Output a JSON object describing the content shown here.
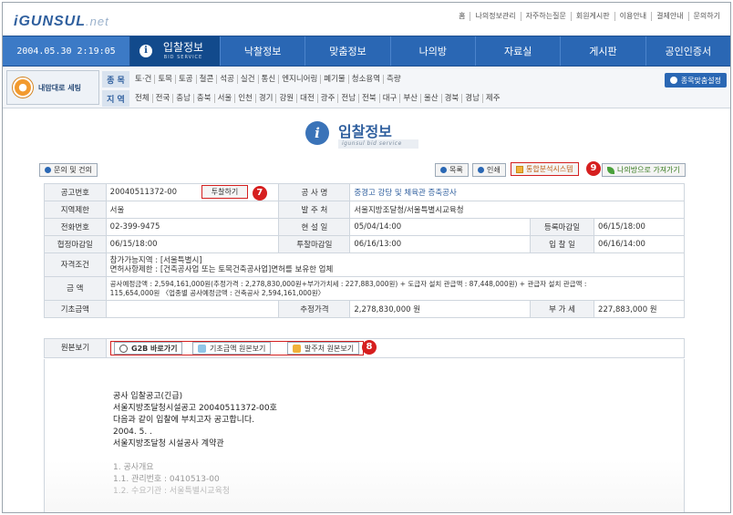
{
  "logo": {
    "main": "iGUNSUL",
    "suffix": ".net"
  },
  "utility_links": [
    "홈",
    "나의정보관리",
    "자주하는질문",
    "회원게시판",
    "이용안내",
    "결제안내",
    "문의하기"
  ],
  "datetime": "2004.05.30 2:19:05",
  "nav": {
    "active": {
      "icon": "i",
      "label": "입찰정보",
      "sub": "BID SERVICE"
    },
    "items": [
      "낙찰정보",
      "맞춤정보",
      "나의방",
      "자료실",
      "게시판",
      "공인인증서"
    ]
  },
  "subnav": {
    "my_setting": "내맘대로 세팅",
    "category_label": "종 목",
    "categories": [
      "토·건",
      "토목",
      "토공",
      "철콘",
      "석공",
      "실건",
      "통신",
      "엔지니어링",
      "폐기물",
      "청소용역",
      "측량"
    ],
    "region_label": "지 역",
    "regions": [
      "전체",
      "전국",
      "충남",
      "충북",
      "서울",
      "인천",
      "경기",
      "강원",
      "대전",
      "광주",
      "전남",
      "전북",
      "대구",
      "부산",
      "울산",
      "경북",
      "경남",
      "제주"
    ],
    "setting_button": "종목맞춤설정"
  },
  "page": {
    "title": "입찰정보",
    "subtitle": "igunsul bid service",
    "title_icon": "i"
  },
  "actions": {
    "inquiry": "문의 및 건의",
    "list": "목록",
    "print": "인쇄",
    "integrated": "통합분석시스템",
    "to_my_room": "나의방으로 가져가기"
  },
  "markers": {
    "bid_button": "7",
    "integrated": "9",
    "original_view": "8"
  },
  "info": {
    "notice_no_label": "공고번호",
    "notice_no": "20040511372-00",
    "bid_button": "투찰하기",
    "project_name_label": "공 사 명",
    "project_name": "중경고 강당 및 체육관 증축공사",
    "region_limit_label": "지역제한",
    "region_limit": "서울",
    "client_label": "발 주 처",
    "client": "서울지방조달청/서울특별시교육청",
    "phone_label": "전화번호",
    "phone": "02-399-9475",
    "site_tour_label": "현 설 일",
    "site_tour": "05/04/14:00",
    "reg_deadline_label": "등록마감일",
    "reg_deadline": "06/15/18:00",
    "agreement_deadline_label": "협정마감일",
    "agreement_deadline": "06/15/18:00",
    "bid_deadline_label": "투찰마감일",
    "bid_deadline": "06/16/13:00",
    "opening_label": "입 찰 일",
    "opening": "06/16/14:00",
    "qualification_label": "자격조건",
    "qualification_1": "참가가능지역 : [서울특별시]",
    "qualification_2": "면허사항제한 : [건축공사업 또는 토목건축공사업]면허를 보유한 업체",
    "amount_label": "금 액",
    "amount_1": "공사예정금액 : 2,594,161,000원(추정가격 : 2,278,830,000원+부가가치세 : 227,883,000원) + 도급자 설치 관급액 : 87,448,000원) + 관급자 설치 관급액 : ",
    "amount_2": "115,654,000원 〈업종별 공사예정금액 : 건축공사 2,594,161,000원〉",
    "base_amount_label": "기초금액",
    "base_amount": "",
    "est_price_label": "추정가격",
    "est_price": "2,278,830,000 원",
    "vat_label": "부 가 세",
    "vat": "227,883,000 원"
  },
  "original": {
    "label": "원본보기",
    "g2b": "G2B 바로가기",
    "base_amount_view": "기초금액 원본보기",
    "client_view": "발주처 원본보기"
  },
  "document": {
    "lines": [
      "공사 입찰공고(긴급)",
      "서울지방조달청시설공고 20040511372-00호",
      "다음과 같이 입찰에 부치고자 공고합니다.",
      "2004. 5. .",
      "서울지방조달청 시설공사 계약관"
    ],
    "section_1": "1. 공사개요",
    "section_1_1": "1.1. 관리번호 : 0410513-00",
    "section_1_2": "1.2. 수요기관 : 서울특별시교육청"
  }
}
